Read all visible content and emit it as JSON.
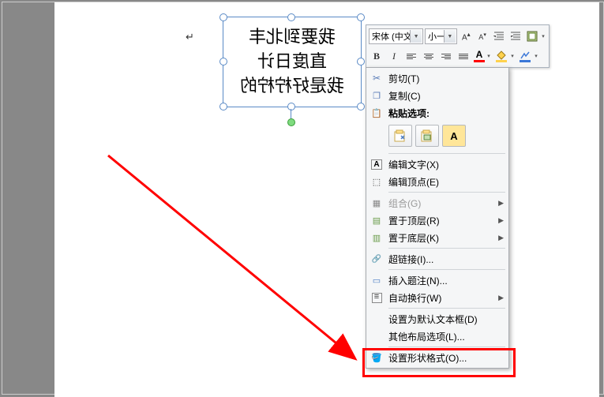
{
  "textbox": {
    "line1": "我要到北丰",
    "line2": "直度日计",
    "line3": "我是好柠柠的"
  },
  "mini_toolbar": {
    "font": "宋体 (中文",
    "size": "小一"
  },
  "menu": {
    "cut": "剪切(T)",
    "copy": "复制(C)",
    "paste_header": "粘贴选项:",
    "edit_text": "编辑文字(X)",
    "edit_vertex": "编辑顶点(E)",
    "group": "组合(G)",
    "bring_front": "置于顶层(R)",
    "send_back": "置于底层(K)",
    "hyperlink": "超链接(I)...",
    "insert_caption": "插入题注(N)...",
    "auto_wrap": "自动换行(W)",
    "set_default": "设置为默认文本框(D)",
    "other_layout": "其他布局选项(L)...",
    "format_shape": "设置形状格式(O)..."
  }
}
